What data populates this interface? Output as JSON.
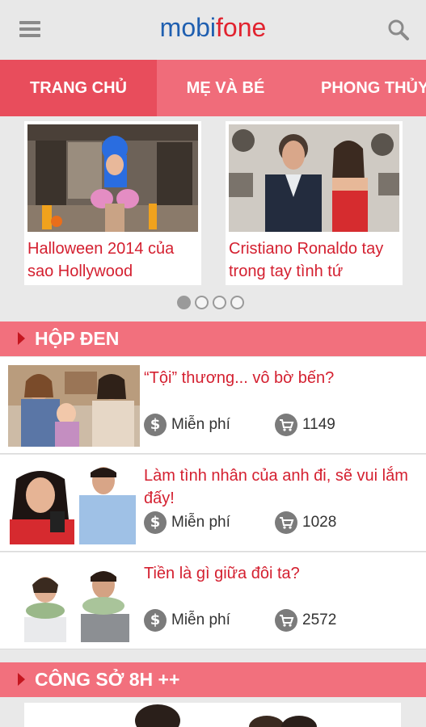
{
  "header": {
    "logo_part1": "mobi",
    "logo_part2": "fone",
    "menu_icon": "hamburger-menu-icon",
    "search_icon": "search-icon"
  },
  "tabs": [
    {
      "label": "TRANG CHỦ",
      "active": true
    },
    {
      "label": "MẸ VÀ BÉ",
      "active": false
    },
    {
      "label": "PHONG THỦY",
      "active": false
    }
  ],
  "featured": [
    {
      "title": "Halloween 2014 của sao Hollywood"
    },
    {
      "title": "Cristiano Ronaldo tay trong tay tình tứ"
    }
  ],
  "carousel": {
    "pages": 4,
    "current": 1
  },
  "sections": [
    {
      "label": "HỘP ĐEN",
      "items": [
        {
          "title": "“Tội” thương... vô bờ bến?",
          "price": "Miễn phí",
          "count": "1149"
        },
        {
          "title": "Làm tình nhân của anh đi, sẽ vui lắm đấy!",
          "price": "Miễn phí",
          "count": "1028"
        },
        {
          "title": "Tiền là gì giữa đôi ta?",
          "price": "Miễn phí",
          "count": "2572"
        }
      ]
    },
    {
      "label": "CÔNG SỞ 8H ++"
    }
  ],
  "icons": {
    "price": "dollar-icon",
    "count": "cart-icon",
    "section_marker": "triangle-right-icon"
  },
  "colors": {
    "accent": "#f06c7a",
    "active_tab": "#e84d5c",
    "title_red": "#d42030",
    "logo_blue": "#1f5fb0",
    "logo_red": "#e1232f"
  }
}
